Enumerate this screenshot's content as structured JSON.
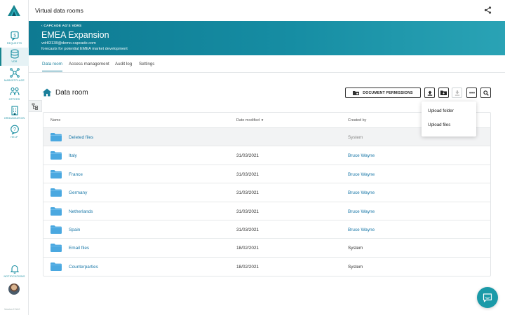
{
  "app": {
    "title": "Virtual data rooms"
  },
  "sidebar": {
    "items": [
      {
        "label": "REQUESTS"
      },
      {
        "label": "VDR",
        "active": true
      },
      {
        "label": "MARKETPLACE"
      },
      {
        "label": "OFFERS"
      },
      {
        "label": "ORGANIZATION"
      },
      {
        "label": "HELP"
      }
    ],
    "notifications_label": "NOTIFICATIONS",
    "version": "Version 2.34.0"
  },
  "banner": {
    "breadcrumb": "‹ CAPCADE AG'S VDRS",
    "title": "EMEA Expansion",
    "email": "vdr83138@demo.capcade.com",
    "description": "forecasts for potential EMEA market development"
  },
  "tabs": [
    {
      "label": "Data room",
      "active": true
    },
    {
      "label": "Access management"
    },
    {
      "label": "Audit log"
    },
    {
      "label": "Settings"
    }
  ],
  "page": {
    "heading": "Data room"
  },
  "toolbar": {
    "permissions_label": "DOCUMENT PERMISSIONS"
  },
  "dropdown": {
    "options": [
      "Upload folder",
      "Upload files"
    ]
  },
  "table": {
    "headers": {
      "name": "Name",
      "date": "Date modified",
      "created": "Created by"
    },
    "rows": [
      {
        "name": "Deleted files",
        "date": "",
        "created": "System"
      },
      {
        "name": "Italy",
        "date": "31/03/2021",
        "created": "Bruce Wayne"
      },
      {
        "name": "France",
        "date": "31/03/2021",
        "created": "Bruce Wayne"
      },
      {
        "name": "Germany",
        "date": "31/03/2021",
        "created": "Bruce Wayne"
      },
      {
        "name": "Netherlands",
        "date": "31/03/2021",
        "created": "Bruce Wayne"
      },
      {
        "name": "Spain",
        "date": "31/03/2021",
        "created": "Bruce Wayne"
      },
      {
        "name": "Email files",
        "date": "18/02/2021",
        "created": "System"
      },
      {
        "name": "Counterparties",
        "date": "18/02/2021",
        "created": "System"
      }
    ]
  },
  "colors": {
    "accent": "#1a7f9b",
    "banner": "#0e7a92",
    "folder": "#4aa8e0",
    "link": "#1a78a8"
  },
  "icons": [
    "logo-icon",
    "requests-icon",
    "vdr-icon",
    "marketplace-icon",
    "offers-icon",
    "organization-icon",
    "help-icon",
    "bell-icon",
    "share-icon",
    "home-icon",
    "tree-view-icon",
    "folder-lock-icon",
    "upload-icon",
    "new-folder-icon",
    "download-icon",
    "more-icon",
    "search-icon",
    "folder-icon",
    "chat-icon"
  ]
}
